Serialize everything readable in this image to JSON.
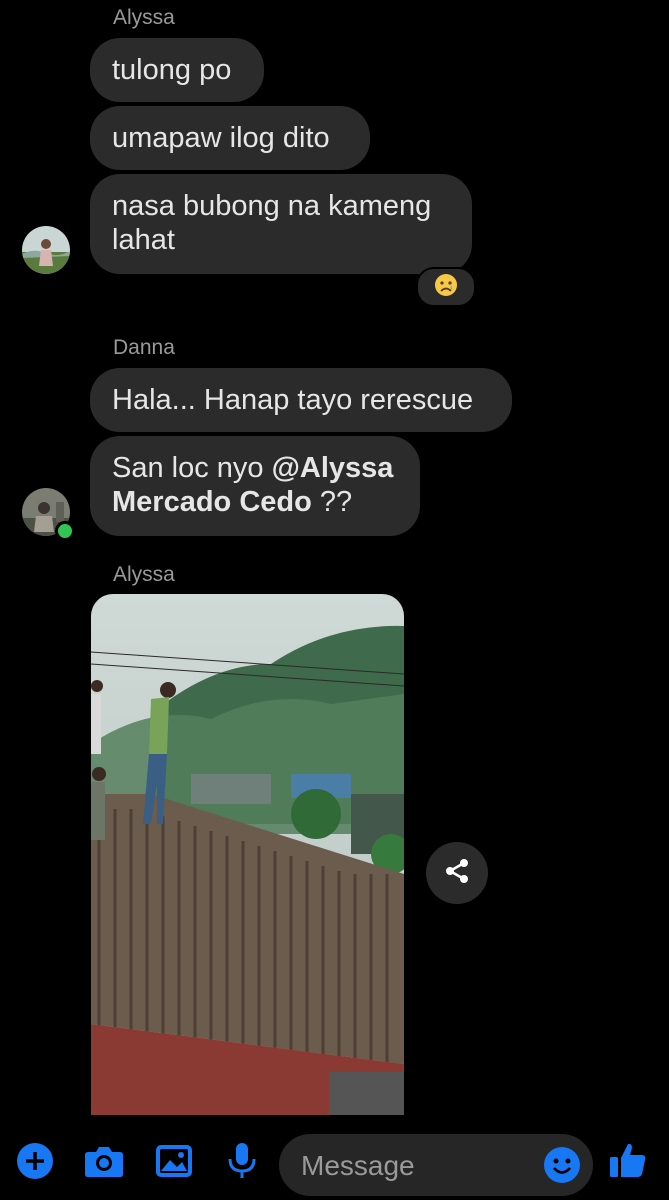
{
  "thread": {
    "group1": {
      "sender": "Alyssa",
      "messages": [
        "tulong po",
        "umapaw ilog dito",
        "nasa bubong na kameng lahat"
      ],
      "reaction": "crying-face"
    },
    "group2": {
      "sender": "Danna",
      "message1": "Hala... Hanap tayo rerescue",
      "message2_prefix": "San loc nyo ",
      "message2_mention": "@Alyssa Mercado Cedo",
      "message2_suffix": " ??"
    },
    "group3": {
      "sender": "Alyssa",
      "attachment": "photo"
    }
  },
  "composer": {
    "placeholder": "Message",
    "tools": [
      "plus-icon",
      "camera-icon",
      "gallery-icon",
      "microphone-icon"
    ],
    "emoji_icon": "smiley-icon",
    "like_icon": "thumbs-up-icon",
    "accent": "#1877f2"
  }
}
